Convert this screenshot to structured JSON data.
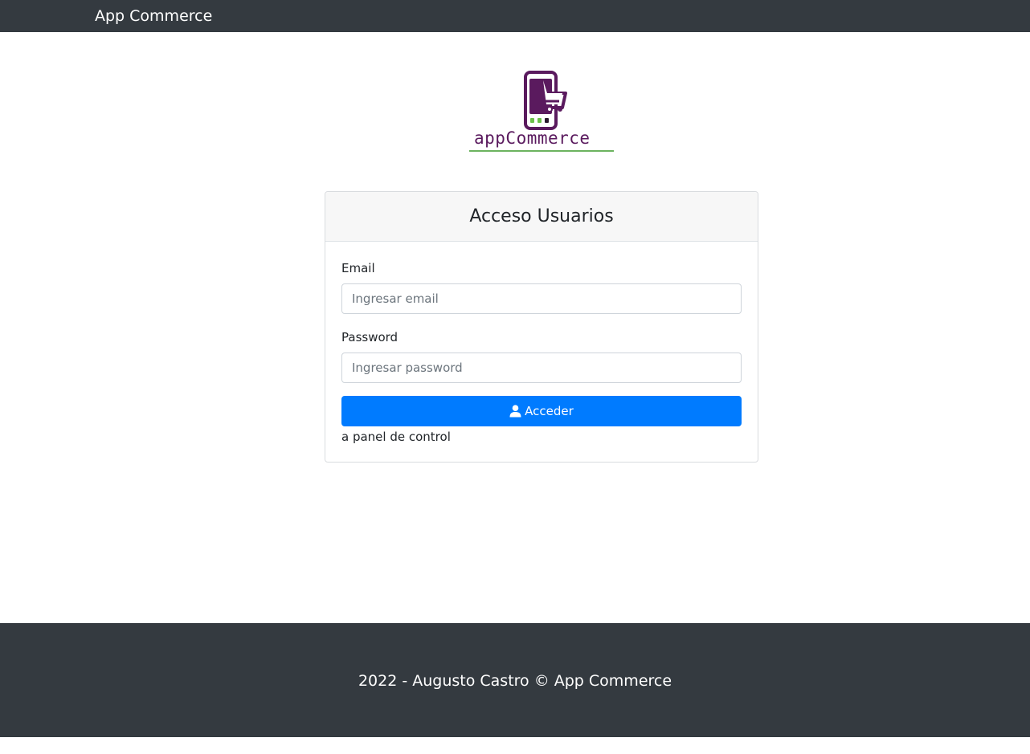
{
  "navbar": {
    "brand": "App Commerce"
  },
  "logo": {
    "wordmark": "appCommerce",
    "colors": {
      "purple": "#5a1a5e",
      "green": "#6cc04a"
    }
  },
  "login_card": {
    "title": "Acceso Usuarios",
    "email": {
      "label": "Email",
      "value": "",
      "placeholder": "Ingresar email"
    },
    "password": {
      "label": "Password",
      "value": "",
      "placeholder": "Ingresar password"
    },
    "submit": {
      "icon": "user-icon",
      "label": "Acceder"
    },
    "subtext": "a panel de control"
  },
  "footer": {
    "text": "2022 - Augusto Castro © App Commerce"
  },
  "colors": {
    "navbar_bg": "#343a40",
    "primary": "#007bff",
    "card_header_bg": "#f7f7f7"
  }
}
